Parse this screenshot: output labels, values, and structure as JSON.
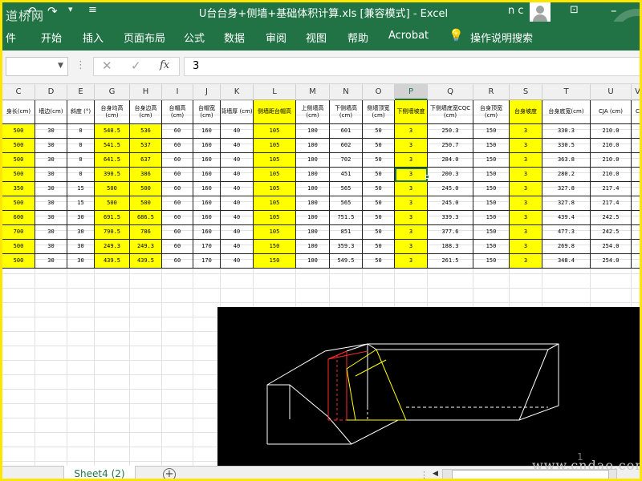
{
  "titlebar": {
    "title": "U台台身+侧墙+基础体积计算.xls  [兼容模式]  -  Excel",
    "watermark": "道桥网",
    "user": "n c",
    "undo_icon": "↶",
    "redo_icon": "↷",
    "customize_icon": "▾",
    "quickaccess_icon": "≡",
    "ribbon_display_icon": "⊡",
    "minimize_icon": "–"
  },
  "ribbon": {
    "tabs": [
      "件",
      "开始",
      "插入",
      "页面布局",
      "公式",
      "数据",
      "审阅",
      "视图",
      "帮助",
      "Acrobat"
    ],
    "tell_me": "操作说明搜索",
    "bulb_icon": "💡"
  },
  "formula_bar": {
    "namebox": "",
    "dropdown_icon": "▼",
    "separator_icon": "⋮",
    "cancel_icon": "✕",
    "enter_icon": "✓",
    "fx_icon": "fx",
    "value": "3"
  },
  "columns": [
    "C",
    "D",
    "E",
    "G",
    "H",
    "I",
    "J",
    "K",
    "L",
    "M",
    "N",
    "O",
    "P",
    "Q",
    "R",
    "S",
    "T",
    "U",
    "V"
  ],
  "selected_column": "P",
  "table": {
    "headers": [
      "身长(cm)",
      "墙边(cm)",
      "斜度 (°)",
      "台身均高 (cm)",
      "台身边高 (cm)",
      "台帽高 (cm)",
      "台帽宽 (cm)",
      "背墙厚 (cm)",
      "侧墙距台帽高",
      "上侧墙高 (cm)",
      "下侧墙高 (cm)",
      "侧墙顶宽 (cm)",
      "下侧墙坡度",
      "下侧墙底宽CQC (cm)",
      "台身顶宽 (cm)",
      "台身坡度",
      "台身底宽(cm)",
      "CJA (cm)",
      "C"
    ],
    "rows": [
      [
        "500",
        "30",
        "0",
        "540.5",
        "536",
        "60",
        "160",
        "40",
        "105",
        "100",
        "601",
        "50",
        "3",
        "250.3",
        "150",
        "3",
        "330.3",
        "210.0",
        ""
      ],
      [
        "500",
        "30",
        "0",
        "541.5",
        "537",
        "60",
        "160",
        "40",
        "105",
        "100",
        "602",
        "50",
        "3",
        "250.7",
        "150",
        "3",
        "330.5",
        "210.0",
        ""
      ],
      [
        "500",
        "30",
        "0",
        "641.5",
        "637",
        "60",
        "160",
        "40",
        "105",
        "100",
        "702",
        "50",
        "3",
        "284.0",
        "150",
        "3",
        "363.8",
        "210.0",
        ""
      ],
      [
        "500",
        "30",
        "0",
        "390.5",
        "386",
        "60",
        "160",
        "40",
        "105",
        "100",
        "451",
        "50",
        "3",
        "200.3",
        "150",
        "3",
        "280.2",
        "210.0",
        ""
      ],
      [
        "350",
        "30",
        "15",
        "500",
        "500",
        "60",
        "160",
        "40",
        "105",
        "100",
        "565",
        "50",
        "3",
        "245.0",
        "150",
        "3",
        "327.8",
        "217.4",
        ""
      ],
      [
        "500",
        "30",
        "15",
        "500",
        "500",
        "60",
        "160",
        "40",
        "105",
        "100",
        "565",
        "50",
        "3",
        "245.0",
        "150",
        "3",
        "327.8",
        "217.4",
        ""
      ],
      [
        "600",
        "30",
        "30",
        "691.5",
        "686.5",
        "60",
        "160",
        "40",
        "105",
        "100",
        "751.5",
        "50",
        "3",
        "339.3",
        "150",
        "3",
        "439.4",
        "242.5",
        ""
      ],
      [
        "700",
        "30",
        "30",
        "790.5",
        "786",
        "60",
        "160",
        "40",
        "105",
        "100",
        "851",
        "50",
        "3",
        "377.6",
        "150",
        "3",
        "477.3",
        "242.5",
        ""
      ],
      [
        "500",
        "30",
        "30",
        "249.3",
        "249.3",
        "60",
        "170",
        "40",
        "150",
        "100",
        "359.3",
        "50",
        "3",
        "188.3",
        "150",
        "3",
        "269.8",
        "254.0",
        ""
      ],
      [
        "500",
        "30",
        "30",
        "439.5",
        "439.5",
        "60",
        "170",
        "40",
        "150",
        "100",
        "549.5",
        "50",
        "3",
        "261.5",
        "150",
        "3",
        "348.4",
        "254.0",
        ""
      ]
    ]
  },
  "sheets": {
    "active": "Sheet4 (2)",
    "add_icon": "+",
    "separator_icon": "⋮",
    "scroll_left_icon": "◀"
  },
  "watermark_bottom": "www.cndao.com",
  "cad_mark": "1",
  "colors": {
    "excel_green": "#217346",
    "highlight_yellow": "#ffff00",
    "frame_yellow": "#ffe600"
  }
}
